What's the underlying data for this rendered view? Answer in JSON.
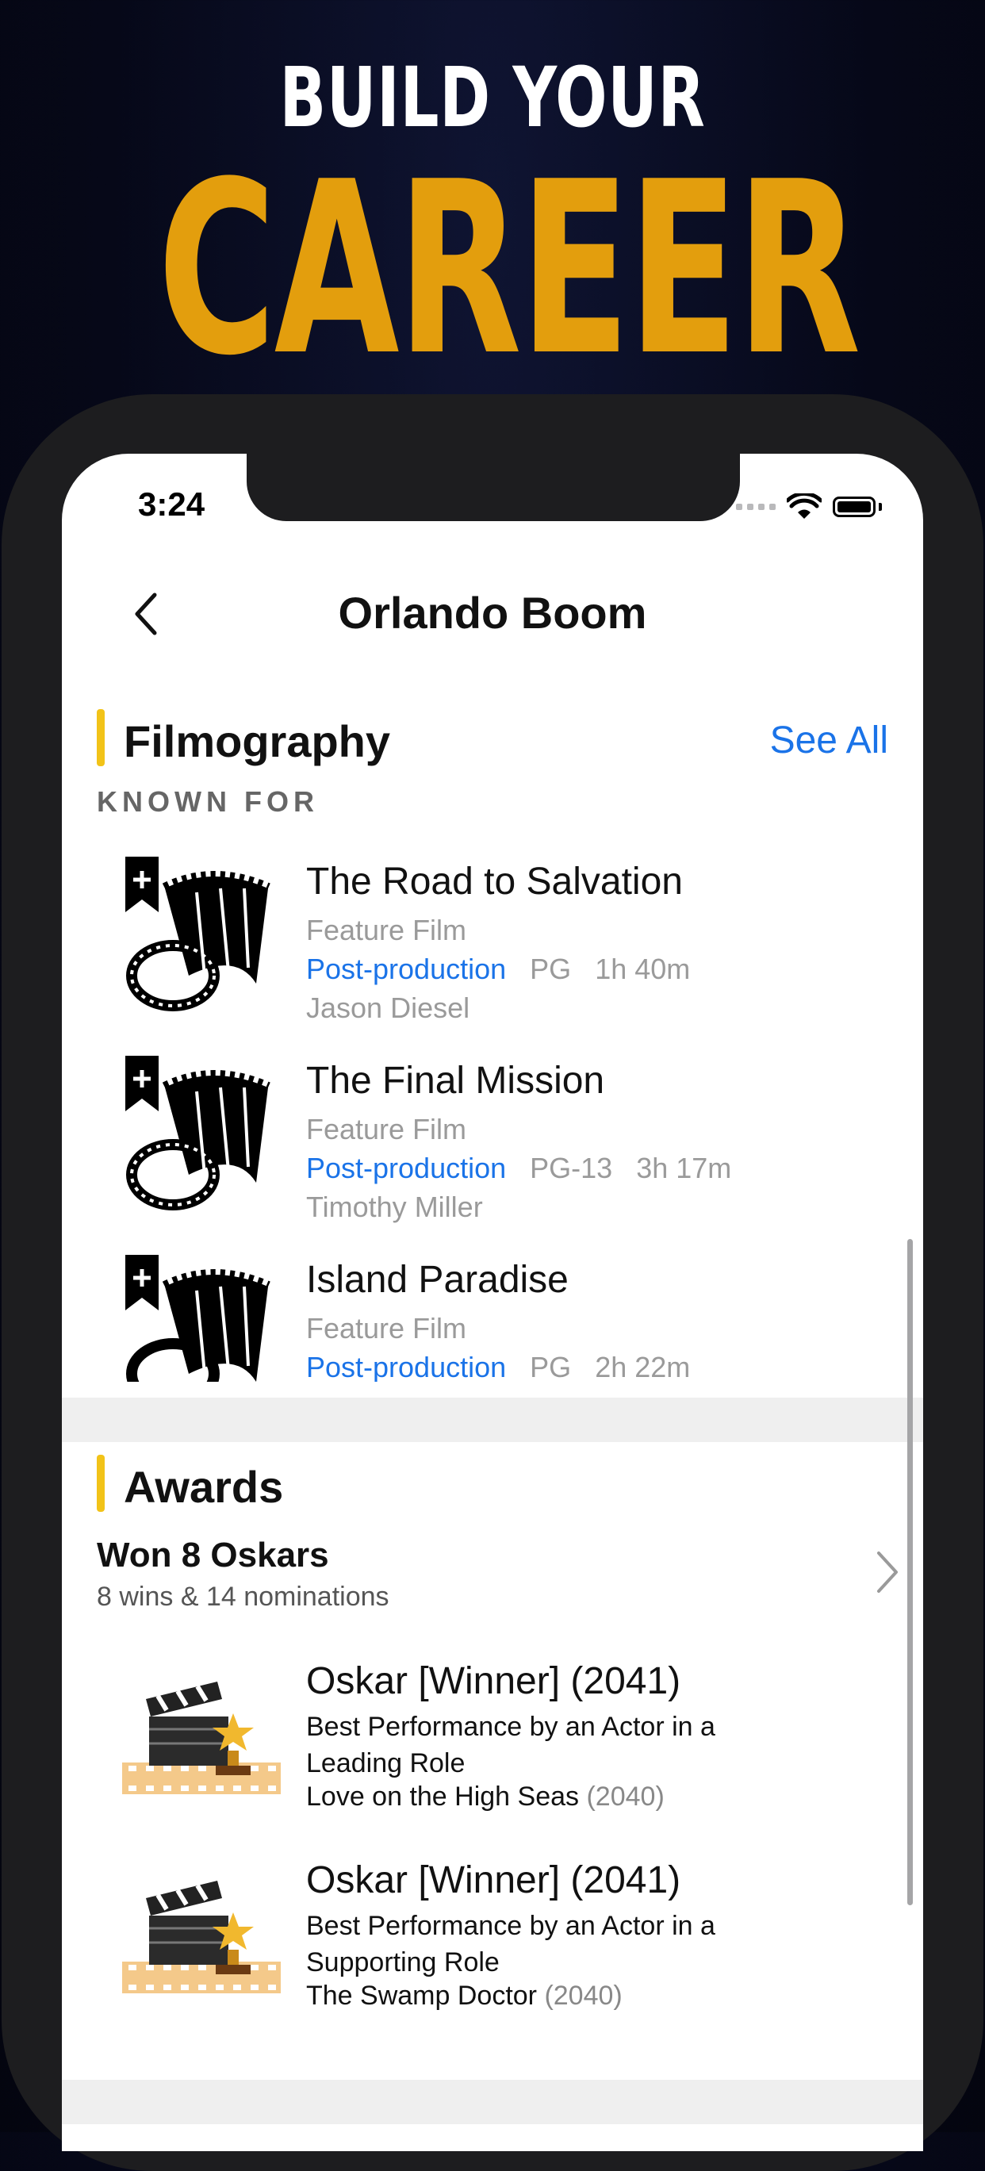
{
  "hero": {
    "line1": "BUILD YOUR",
    "line2": "CAREER"
  },
  "status_bar": {
    "time": "3:24"
  },
  "nav": {
    "title": "Orlando Boom",
    "back_icon": "chevron-left-icon"
  },
  "filmography": {
    "title": "Filmography",
    "see_all": "See All",
    "known_for": "KNOWN FOR",
    "items": [
      {
        "title": "The Road to Salvation",
        "type": "Feature Film",
        "status": "Post-production",
        "rating": "PG",
        "duration": "1h 40m",
        "director": "Jason Diesel"
      },
      {
        "title": "The Final Mission",
        "type": "Feature Film",
        "status": "Post-production",
        "rating": "PG-13",
        "duration": "3h 17m",
        "director": "Timothy Miller"
      },
      {
        "title": "Island Paradise",
        "type": "Feature Film",
        "status": "Post-production",
        "rating": "PG",
        "duration": "2h 22m",
        "director": ""
      }
    ]
  },
  "awards": {
    "title": "Awards",
    "summary_title": "Won 8 Oskars",
    "summary_sub": "8 wins & 14 nominations",
    "items": [
      {
        "title": "Oskar [Winner] (2041)",
        "category": "Best Performance by an Actor in a Leading Role",
        "film": "Love on the High Seas",
        "film_year": "(2040)"
      },
      {
        "title": "Oskar [Winner] (2041)",
        "category": "Best Performance by an Actor in a Supporting Role",
        "film": "The Swamp Doctor",
        "film_year": "(2040)"
      }
    ]
  },
  "colors": {
    "accent": "#e39e0d",
    "link": "#1a73e8",
    "section_bar": "#f2c318"
  }
}
